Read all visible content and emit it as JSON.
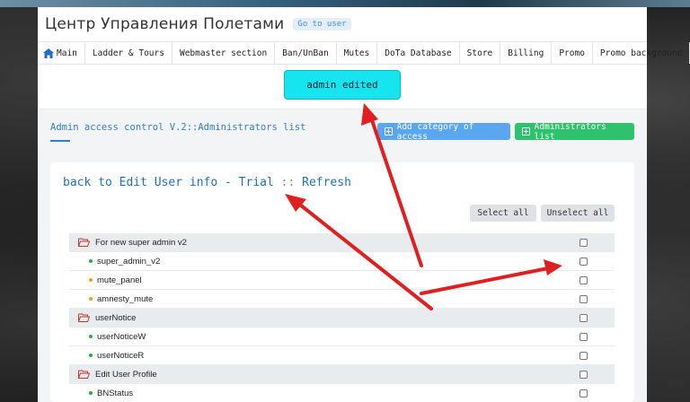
{
  "header": {
    "title": "Центр Управления Полетами",
    "goto_link": "Go to user"
  },
  "nav": {
    "items": [
      "Main",
      "Ladder & Tours",
      "Webmaster section",
      "Ban/UnBan",
      "Mutes",
      "DoTa Database",
      "Store",
      "Billing",
      "Promo",
      "Promo background"
    ]
  },
  "message": "admin edited",
  "section": {
    "title": "Admin access control V.2::Administrators list",
    "add_category_label": "Add category of access",
    "administrators_list_label": "Administrators list"
  },
  "card": {
    "back_link": "back to Edit User info - Trial",
    "separator": "::",
    "refresh_link": "Refresh",
    "select_all": "Select all",
    "unselect_all": "Unselect all"
  },
  "permissions": [
    {
      "type": "category",
      "label": "For new super admin v2"
    },
    {
      "type": "perm",
      "label": "super_admin_v2",
      "dot": "green"
    },
    {
      "type": "perm",
      "label": "mute_panel",
      "dot": "orange"
    },
    {
      "type": "perm",
      "label": "amnesty_mute",
      "dot": "orange"
    },
    {
      "type": "category",
      "label": "userNotice"
    },
    {
      "type": "perm",
      "label": "userNoticeW",
      "dot": "green"
    },
    {
      "type": "perm",
      "label": "userNoticeR",
      "dot": "green"
    },
    {
      "type": "category",
      "label": "Edit User Profile"
    },
    {
      "type": "perm",
      "label": "BNStatus",
      "dot": "green"
    }
  ],
  "colors": {
    "accent": "#2e7fc9",
    "message_bg": "#16e4ee",
    "add_category_bg": "#5aa7ef",
    "admins_list_bg": "#2ec26c",
    "arrow": "#e02020",
    "dot_green": "#2aa84a",
    "dot_orange": "#f0a020"
  },
  "icons": {
    "home": "home-icon",
    "folder": "folder-open-icon",
    "plus": "plus-square-icon"
  }
}
